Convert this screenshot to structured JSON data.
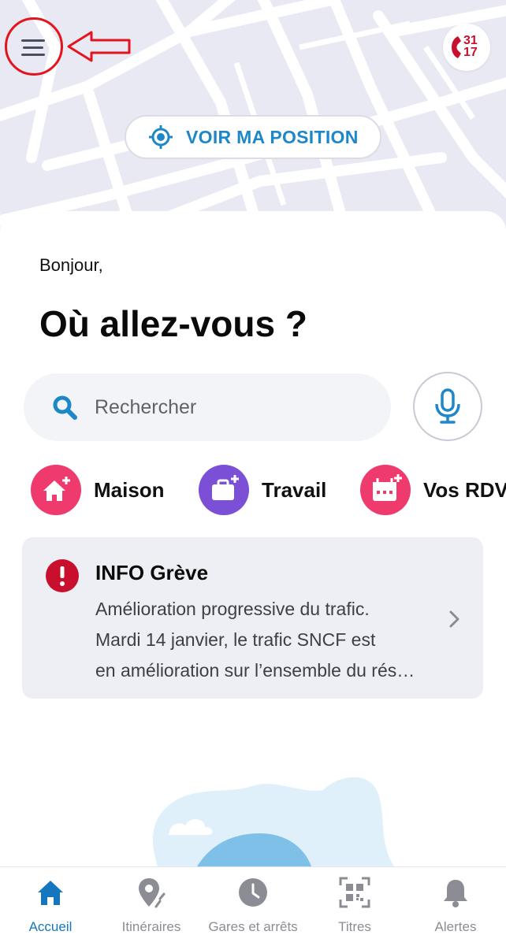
{
  "map": {
    "position_button_label": "VOIR MA POSITION"
  },
  "header": {
    "emergency_number_top": "31",
    "emergency_number_bottom": "17"
  },
  "main": {
    "greeting": "Bonjour,",
    "headline": "Où allez-vous ?"
  },
  "search": {
    "placeholder": "Rechercher"
  },
  "shortcuts": [
    {
      "label": "Maison",
      "icon": "home-add-icon",
      "color": "#ee3a6c"
    },
    {
      "label": "Travail",
      "icon": "briefcase-add-icon",
      "color": "#7b4fd6"
    },
    {
      "label": "Vos RDV",
      "icon": "calendar-add-icon",
      "color": "#ee3a6c"
    }
  ],
  "info": {
    "title": "INFO Grève",
    "lines": [
      "Amélioration progressive du trafic.",
      "Mardi 14 janvier, le trafic SNCF est",
      "en amélioration sur l’ensemble du rés…"
    ]
  },
  "tabs": [
    {
      "label": "Accueil",
      "icon": "home-icon",
      "active": true
    },
    {
      "label": "Itinéraires",
      "icon": "route-pin-icon",
      "active": false
    },
    {
      "label": "Gares et arrêts",
      "icon": "clock-icon",
      "active": false
    },
    {
      "label": "Titres",
      "icon": "qr-code-icon",
      "active": false
    },
    {
      "label": "Alertes",
      "icon": "bell-icon",
      "active": false
    }
  ],
  "colors": {
    "accent_blue": "#1e87c8",
    "tab_active": "#1477bd",
    "brand_red": "#c8102e",
    "alert_red": "#c8102e",
    "shortcut_pink": "#ee3a6c",
    "shortcut_purple": "#7b4fd6"
  }
}
